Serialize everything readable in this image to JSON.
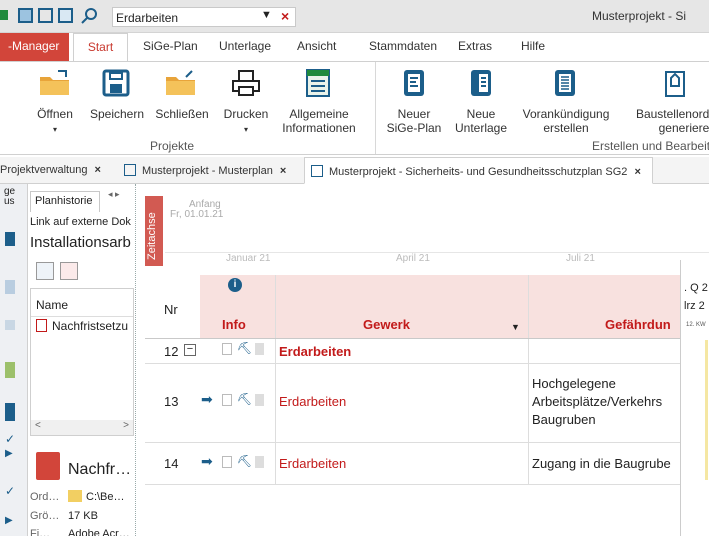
{
  "app": {
    "title": "Musterprojekt - Si",
    "search_value": "Erdarbeiten"
  },
  "ribbon_tabs": [
    "-Manager",
    "Start",
    "SiGe-Plan",
    "Unterlage",
    "Ansicht",
    "Stammdaten",
    "Extras",
    "Hilfe"
  ],
  "ribbon": {
    "group_projekte": "Projekte",
    "group_erstellen": "Erstellen und Bearbeit",
    "btn_oeffnen": "Öffnen",
    "btn_speichern": "Speichern",
    "btn_schliessen": "Schließen",
    "btn_drucken": "Drucken",
    "btn_allgemeine_1": "Allgemeine",
    "btn_allgemeine_2": "Informationen",
    "btn_neuer_1": "Neuer",
    "btn_neuer_2": "SiGe-Plan",
    "btn_neue_1": "Neue",
    "btn_neue_2": "Unterlage",
    "btn_vorank_1": "Vorankündigung",
    "btn_vorank_2": "erstellen",
    "btn_baust_1": "Baustellenordn",
    "btn_baust_2": "generieren"
  },
  "doc_tabs": [
    "Projektverwaltung",
    "Musterprojekt - Musterplan",
    "Musterprojekt - Sicherheits- und Gesundheitsschutzplan SG2"
  ],
  "left_strip": {
    "top1": "ge",
    "top2": "us"
  },
  "plan_pane": {
    "tab_label": "Planhistorie",
    "link_label": "Link auf externe Dok",
    "install_label": "Installationsarb",
    "name_header": "Name",
    "file_name": "Nachfristsetzu",
    "detail_title": "Nachfr…",
    "ord_label": "Ord…",
    "ord_value": "C:\\Be…",
    "gro_label": "Grö…",
    "gro_value": "17 KB",
    "fi_label": "Fi…",
    "fi_value": "Adobe Acr…"
  },
  "timeline": {
    "zeitachse": "Zeitachse",
    "anfang": "Anfang",
    "anfang_date": "Fr, 01.01.21",
    "months": [
      "Januar 21",
      "April 21",
      "Juli 21"
    ],
    "q_label": ". Q 2",
    "month_label": "lrz 2",
    "week_label": "12. KW"
  },
  "grid": {
    "col_nr": "Nr",
    "col_info": "Info",
    "col_gewerk": "Gewerk",
    "col_gefaehrdung": "Gefährdun",
    "rows": [
      {
        "nr": "12",
        "gewerk": "Erdarbeiten",
        "gefaehrdung": ""
      },
      {
        "nr": "13",
        "gewerk": "Erdarbeiten",
        "gefaehrdung_lines": [
          "Hochgelegene",
          "Arbeitsplätze/Verkehrs",
          "Baugruben"
        ]
      },
      {
        "nr": "14",
        "gewerk": "Erdarbeiten",
        "gefaehrdung": "Zugang in die Baugrube"
      }
    ]
  },
  "colors": {
    "accent_red": "#d2453a",
    "ribbon_blue": "#1c5e8a",
    "header_pink": "#f8e1df",
    "gewerk_red": "#c21a1a"
  }
}
